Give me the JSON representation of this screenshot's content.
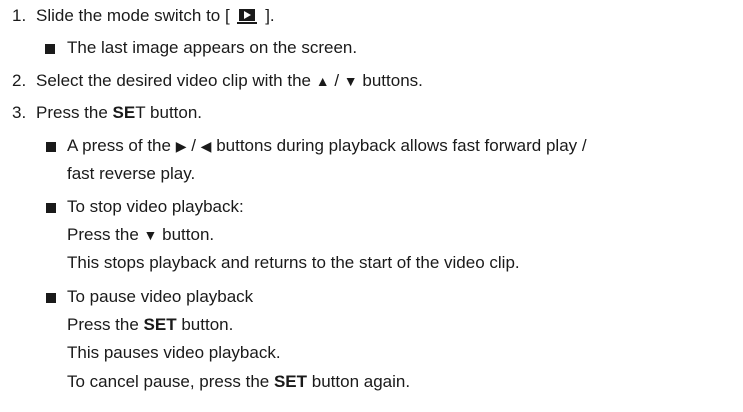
{
  "steps": [
    {
      "number": "1.",
      "pre": "Slide the mode switch to [",
      "post": "].",
      "icon": "playback-mode-icon",
      "bullets": [
        {
          "text": "The last image appears on the screen."
        }
      ]
    },
    {
      "number": "2.",
      "pre": "Select the desired video clip with the",
      "up": "▲",
      "sep": "/",
      "down": "▼",
      "post": "buttons."
    },
    {
      "number": "3.",
      "pre": "Press the",
      "bold1": "SE",
      "plain1": "T",
      "post": "button.",
      "bullets": [
        {
          "pre": "A press of the",
          "right": "▶",
          "sep": "/",
          "left": "◀",
          "post": "buttons during playback allows fast forward play /",
          "cont": "fast reverse play."
        },
        {
          "head": "To stop video playback:",
          "line1_pre": "Press the",
          "line1_down": "▼",
          "line1_post": "button.",
          "line2": "This stops playback and returns to the start of the video clip."
        },
        {
          "head": "To pause video playback",
          "line1_pre": "Press the",
          "line1_bold": "SET",
          "line1_post": "button.",
          "line2": "This pauses video playback.",
          "line3_pre": "To cancel pause, press the",
          "line3_bold": "SET",
          "line3_post": "button again."
        }
      ]
    }
  ]
}
